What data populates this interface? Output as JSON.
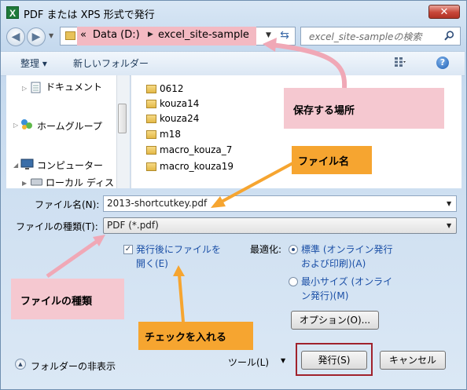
{
  "window": {
    "title": "PDF または XPS 形式で発行",
    "app_icon_glyph": "X",
    "close_glyph": "✕"
  },
  "address": {
    "prefix": "«",
    "segments": [
      "Data (D:)",
      "excel_site-sample"
    ],
    "search_placeholder": "excel_site-sampleの検索"
  },
  "toolbar": {
    "organize_label": "整理 ▾",
    "new_folder_label": "新しいフォルダー"
  },
  "nav_pane": {
    "items": [
      "ドキュメント",
      "ホームグループ",
      "コンピューター",
      "ローカル ディス"
    ]
  },
  "files": [
    "0612",
    "kouza14",
    "kouza24",
    "m18",
    "macro_kouza_7",
    "macro_kouza19"
  ],
  "form": {
    "filename_label": "ファイル名(N):",
    "filename_value": "2013-shortcutkey.pdf",
    "filetype_label": "ファイルの種類(T):",
    "filetype_value": "PDF (*.pdf)",
    "open_after_line1": "発行後にファイルを",
    "open_after_line2": "開く(E)",
    "optimize_label": "最適化:",
    "opt_standard_line1": "標準 (オンライン発行",
    "opt_standard_line2": "および印刷)(A)",
    "opt_min_line1": "最小サイズ (オンライ",
    "opt_min_line2": "ン発行)(M)",
    "options_button": "オプション(O)..."
  },
  "footer": {
    "hide_folders": "フォルダーの非表示",
    "tools": "ツール(L)",
    "publish": "発行(S)",
    "cancel": "キャンセル"
  },
  "annotations": {
    "save_location": "保存する場所",
    "file_name": "ファイル名",
    "file_type": "ファイルの種類",
    "check_it": "チェックを入れる"
  },
  "colors": {
    "pink_callout": "#f5c8d0",
    "orange_callout": "#f6a530",
    "highlight_frame": "#a0222c"
  }
}
